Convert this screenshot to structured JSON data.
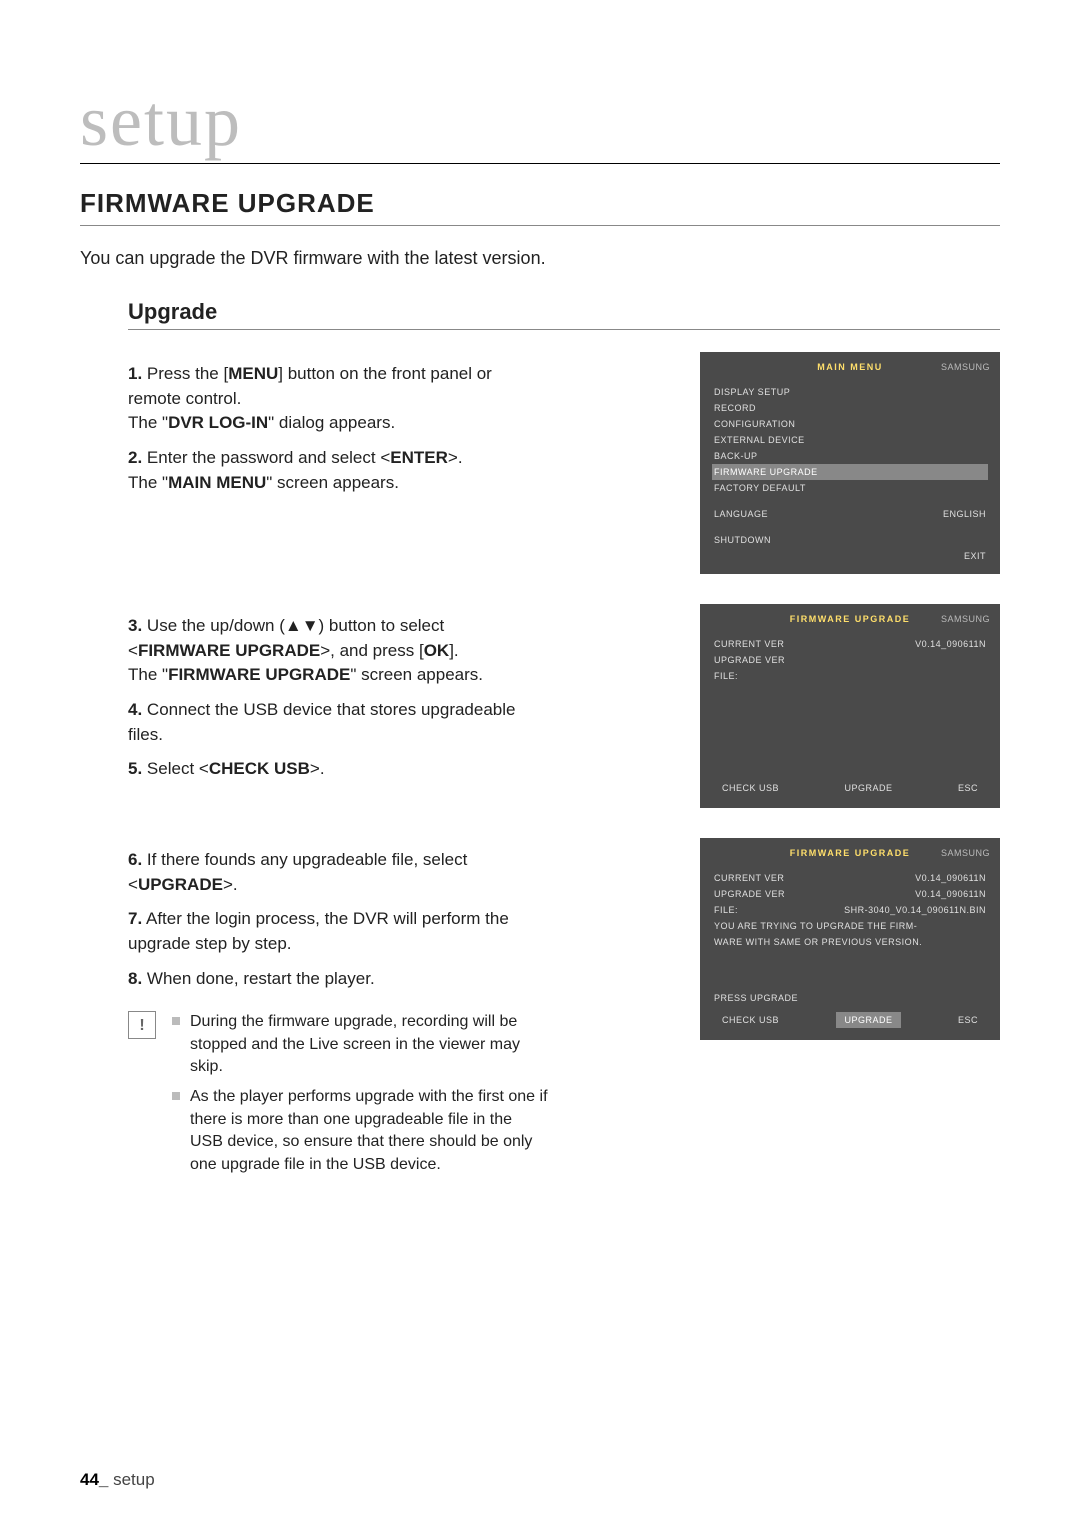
{
  "page": {
    "chapter": "setup",
    "heading": "FIRMWARE UPGRADE",
    "intro": "You can upgrade the DVR firmware with the latest version.",
    "subheading": "Upgrade",
    "footer_num": "44_",
    "footer_text": " setup"
  },
  "steps_a": {
    "s1_a": "1.",
    "s1_b": "Press the [",
    "s1_c": "MENU",
    "s1_d": "] button on the front panel or remote control.",
    "s1_e": "The \"",
    "s1_f": "DVR LOG-IN",
    "s1_g": "\" dialog appears.",
    "s2_a": "2.",
    "s2_b": "Enter the password and select <",
    "s2_c": "ENTER",
    "s2_d": ">.",
    "s2_e": "The \"",
    "s2_f": "MAIN MENU",
    "s2_g": "\" screen appears."
  },
  "steps_b": {
    "s3_a": "3.",
    "s3_b": "Use the up/down (▲▼) button to select <",
    "s3_c": "FIRMWARE UPGRADE",
    "s3_d": ">, and press [",
    "s3_e": "OK",
    "s3_f": "].",
    "s3_g": "The \"",
    "s3_h": "FIRMWARE UPGRADE",
    "s3_i": "\" screen appears.",
    "s4_a": "4.",
    "s4_b": "Connect the USB device that stores upgradeable files.",
    "s5_a": "5.",
    "s5_b": "Select <",
    "s5_c": "CHECK USB",
    "s5_d": ">."
  },
  "steps_c": {
    "s6_a": "6.",
    "s6_b": "If there founds any upgradeable file, select <",
    "s6_c": "UPGRADE",
    "s6_d": ">.",
    "s7_a": "7.",
    "s7_b": "After the login process, the DVR will perform the upgrade step by step.",
    "s8_a": "8.",
    "s8_b": "When done, restart the player."
  },
  "notes": {
    "icon": "!",
    "n1": "During the firmware upgrade, recording will be stopped and the Live screen in the viewer may skip.",
    "n2": "As the player performs upgrade with the first one if there is more than one upgradeable file in the USB device, so ensure that there should be only one upgrade file in the USB device."
  },
  "screen1": {
    "title": "MAIN MENU",
    "brand": "SAMSUNG",
    "items": [
      "DISPLAY SETUP",
      "RECORD",
      "CONFIGURATION",
      "EXTERNAL DEVICE",
      "BACK-UP",
      "FIRMWARE UPGRADE",
      "FACTORY DEFAULT"
    ],
    "lang_label": "LANGUAGE",
    "lang_value": "ENGLISH",
    "shutdown": "SHUTDOWN",
    "exit": "EXIT"
  },
  "screen2": {
    "title": "FIRMWARE UPGRADE",
    "brand": "SAMSUNG",
    "cur_label": "CURRENT VER",
    "cur_value": "V0.14_090611N",
    "upg_label": "UPGRADE VER",
    "file_label": "FILE:",
    "check": "CHECK USB",
    "upgrade": "UPGRADE",
    "esc": "ESC"
  },
  "screen3": {
    "title": "FIRMWARE UPGRADE",
    "brand": "SAMSUNG",
    "cur_label": "CURRENT VER",
    "cur_value": "V0.14_090611N",
    "upg_label": "UPGRADE VER",
    "upg_value": "V0.14_090611N",
    "file_label": "FILE:",
    "file_value": "SHR-3040_V0.14_090611N.BIN",
    "warn1": "YOU ARE TRYING TO UPGRADE THE FIRM-",
    "warn2": "WARE WITH SAME OR PREVIOUS VERSION.",
    "press": "PRESS UPGRADE",
    "check": "CHECK USB",
    "upgrade": "UPGRADE",
    "esc": "ESC"
  }
}
